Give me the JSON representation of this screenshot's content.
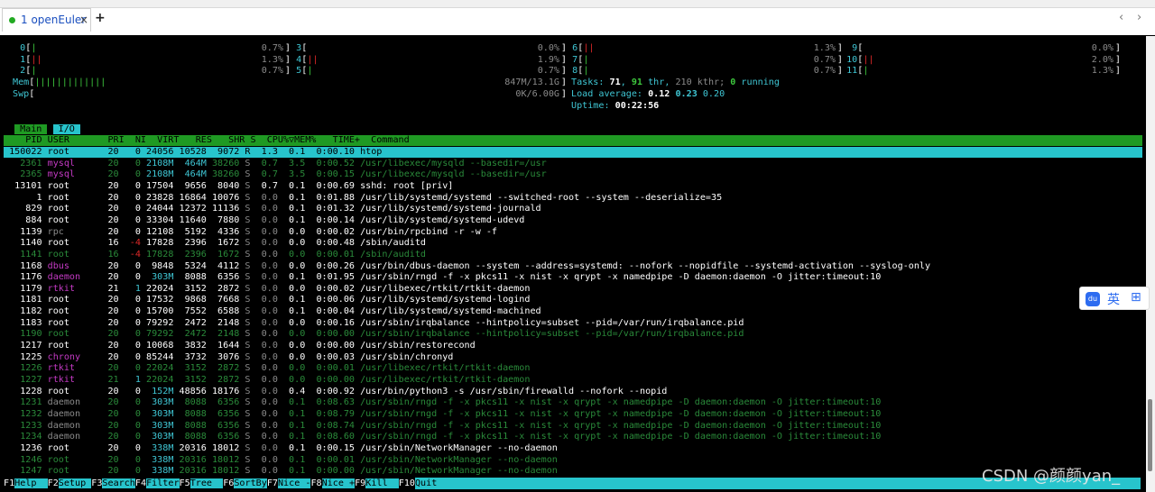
{
  "tab": {
    "label": "1 openEuler",
    "close": "×",
    "new": "+",
    "prev": "‹",
    "next": "›",
    "status_color": "#22aa22"
  },
  "cpu": [
    {
      "id": "0",
      "bar": "|",
      "pct": "0.7%"
    },
    {
      "id": "1",
      "bar": "||",
      "pct": "1.3%"
    },
    {
      "id": "2",
      "bar": "|",
      "pct": "0.7%"
    },
    {
      "id": "3",
      "bar": "",
      "pct": "0.0%"
    },
    {
      "id": "4",
      "bar": "||",
      "pct": "1.9%"
    },
    {
      "id": "5",
      "bar": "|",
      "pct": "0.7%"
    },
    {
      "id": "6",
      "bar": "||",
      "pct": "1.3%"
    },
    {
      "id": "7",
      "bar": "|",
      "pct": "0.7%"
    },
    {
      "id": "8",
      "bar": "|",
      "pct": "0.7%"
    },
    {
      "id": "9",
      "bar": "",
      "pct": "0.0%"
    },
    {
      "id": "10",
      "bar": "||",
      "pct": "2.0%"
    },
    {
      "id": "11",
      "bar": "|",
      "pct": "1.3%"
    }
  ],
  "mem": {
    "label": "Mem",
    "bar": "|||||||||||||",
    "value": "847M/13.1G"
  },
  "swp": {
    "label": "Swp",
    "bar": "",
    "value": "0K/6.00G"
  },
  "tasks": {
    "label": "Tasks:",
    "tasks": "71",
    "sep": ",",
    "thr": "91",
    "thr_label": "thr,",
    "kthr": "210 kthr;",
    "running": "0",
    "running_label": "running"
  },
  "load": {
    "label": "Load average:",
    "v1": "0.12",
    "v2": "0.23",
    "v3": "0.20"
  },
  "uptime": {
    "label": "Uptime:",
    "value": "00:22:56"
  },
  "screen_tabs": {
    "main": "Main",
    "io": "I/O"
  },
  "header": {
    "text": "    PID USER       PRI  NI  VIRT   RES   SHR S  CPU%▽MEM%   TIME+  Command"
  },
  "processes": [
    {
      "pid": "150022",
      "user": "root",
      "pri": "20",
      "ni": "0",
      "virt": "24056",
      "res": "10528",
      "shr": "9072",
      "s": "R",
      "cpu": "1.3",
      "mem": "0.1",
      "time": "0:00.10",
      "cmd": "htop",
      "sel": true
    },
    {
      "pid": "2361",
      "user": "mysql",
      "pri": "20",
      "ni": "0",
      "virt": "2108M",
      "res": "464M",
      "shr": "38260",
      "s": "S",
      "cpu": "0.7",
      "mem": "3.5",
      "time": "0:00.52",
      "cmd": "/usr/libexec/mysqld --basedir=/usr",
      "thread": true,
      "uc": "m"
    },
    {
      "pid": "2365",
      "user": "mysql",
      "pri": "20",
      "ni": "0",
      "virt": "2108M",
      "res": "464M",
      "shr": "38260",
      "s": "S",
      "cpu": "0.7",
      "mem": "3.5",
      "time": "0:00.15",
      "cmd": "/usr/libexec/mysqld --basedir=/usr",
      "thread": true,
      "uc": "m"
    },
    {
      "pid": "13101",
      "user": "root",
      "pri": "20",
      "ni": "0",
      "virt": "17504",
      "res": "9656",
      "shr": "8040",
      "s": "S",
      "cpu": "0.7",
      "mem": "0.1",
      "time": "0:00.69",
      "cmd": "sshd: root [priv]"
    },
    {
      "pid": "1",
      "user": "root",
      "pri": "20",
      "ni": "0",
      "virt": "23828",
      "res": "16864",
      "shr": "10076",
      "s": "S",
      "cpu": "0.0",
      "mem": "0.1",
      "time": "0:01.88",
      "cmd": "/usr/lib/systemd/systemd --switched-root --system --deserialize=35"
    },
    {
      "pid": "829",
      "user": "root",
      "pri": "20",
      "ni": "0",
      "virt": "24044",
      "res": "12372",
      "shr": "11136",
      "s": "S",
      "cpu": "0.0",
      "mem": "0.1",
      "time": "0:01.32",
      "cmd": "/usr/lib/systemd/systemd-journald"
    },
    {
      "pid": "884",
      "user": "root",
      "pri": "20",
      "ni": "0",
      "virt": "33304",
      "res": "11640",
      "shr": "7880",
      "s": "S",
      "cpu": "0.0",
      "mem": "0.1",
      "time": "0:00.14",
      "cmd": "/usr/lib/systemd/systemd-udevd"
    },
    {
      "pid": "1139",
      "user": "rpc",
      "pri": "20",
      "ni": "0",
      "virt": "12108",
      "res": "5192",
      "shr": "4336",
      "s": "S",
      "cpu": "0.0",
      "mem": "0.0",
      "time": "0:00.02",
      "cmd": "/usr/bin/rpcbind -r -w -f",
      "uc": "gr"
    },
    {
      "pid": "1140",
      "user": "root",
      "pri": "16",
      "ni": "-4",
      "virt": "17828",
      "res": "2396",
      "shr": "1672",
      "s": "S",
      "cpu": "0.0",
      "mem": "0.0",
      "time": "0:00.48",
      "cmd": "/sbin/auditd"
    },
    {
      "pid": "1141",
      "user": "root",
      "pri": "16",
      "ni": "-4",
      "virt": "17828",
      "res": "2396",
      "shr": "1672",
      "s": "S",
      "cpu": "0.0",
      "mem": "0.0",
      "time": "0:00.01",
      "cmd": "/sbin/auditd",
      "thread": true
    },
    {
      "pid": "1168",
      "user": "dbus",
      "pri": "20",
      "ni": "0",
      "virt": "9848",
      "res": "5324",
      "shr": "4112",
      "s": "S",
      "cpu": "0.0",
      "mem": "0.0",
      "time": "0:00.26",
      "cmd": "/usr/bin/dbus-daemon --system --address=systemd: --nofork --nopidfile --systemd-activation --syslog-only",
      "uc": "m"
    },
    {
      "pid": "1176",
      "user": "daemon",
      "pri": "20",
      "ni": "0",
      "virt": "303M",
      "res": "8088",
      "shr": "6356",
      "s": "S",
      "cpu": "0.0",
      "mem": "0.1",
      "time": "0:01.95",
      "cmd": "/usr/sbin/rngd -f -x pkcs11 -x nist -x qrypt -x namedpipe -D daemon:daemon -O jitter:timeout:10",
      "uc": "m"
    },
    {
      "pid": "1179",
      "user": "rtkit",
      "pri": "21",
      "ni": "1",
      "virt": "22024",
      "res": "3152",
      "shr": "2872",
      "s": "S",
      "cpu": "0.0",
      "mem": "0.0",
      "time": "0:00.02",
      "cmd": "/usr/libexec/rtkit/rtkit-daemon",
      "uc": "m"
    },
    {
      "pid": "1181",
      "user": "root",
      "pri": "20",
      "ni": "0",
      "virt": "17532",
      "res": "9868",
      "shr": "7668",
      "s": "S",
      "cpu": "0.0",
      "mem": "0.1",
      "time": "0:00.06",
      "cmd": "/usr/lib/systemd/systemd-logind"
    },
    {
      "pid": "1182",
      "user": "root",
      "pri": "20",
      "ni": "0",
      "virt": "15700",
      "res": "7552",
      "shr": "6588",
      "s": "S",
      "cpu": "0.0",
      "mem": "0.1",
      "time": "0:00.04",
      "cmd": "/usr/lib/systemd/systemd-machined"
    },
    {
      "pid": "1183",
      "user": "root",
      "pri": "20",
      "ni": "0",
      "virt": "79292",
      "res": "2472",
      "shr": "2148",
      "s": "S",
      "cpu": "0.0",
      "mem": "0.0",
      "time": "0:00.16",
      "cmd": "/usr/sbin/irqbalance --hintpolicy=subset --pid=/var/run/irqbalance.pid"
    },
    {
      "pid": "1190",
      "user": "root",
      "pri": "20",
      "ni": "0",
      "virt": "79292",
      "res": "2472",
      "shr": "2148",
      "s": "S",
      "cpu": "0.0",
      "mem": "0.0",
      "time": "0:00.00",
      "cmd": "/usr/sbin/irqbalance --hintpolicy=subset --pid=/var/run/irqbalance.pid",
      "thread": true
    },
    {
      "pid": "1217",
      "user": "root",
      "pri": "20",
      "ni": "0",
      "virt": "10068",
      "res": "3832",
      "shr": "1644",
      "s": "S",
      "cpu": "0.0",
      "mem": "0.0",
      "time": "0:00.00",
      "cmd": "/usr/sbin/restorecond"
    },
    {
      "pid": "1225",
      "user": "chrony",
      "pri": "20",
      "ni": "0",
      "virt": "85244",
      "res": "3732",
      "shr": "3076",
      "s": "S",
      "cpu": "0.0",
      "mem": "0.0",
      "time": "0:00.03",
      "cmd": "/usr/sbin/chronyd",
      "uc": "m"
    },
    {
      "pid": "1226",
      "user": "rtkit",
      "pri": "20",
      "ni": "0",
      "virt": "22024",
      "res": "3152",
      "shr": "2872",
      "s": "S",
      "cpu": "0.0",
      "mem": "0.0",
      "time": "0:00.01",
      "cmd": "/usr/libexec/rtkit/rtkit-daemon",
      "thread": true,
      "uc": "m"
    },
    {
      "pid": "1227",
      "user": "rtkit",
      "pri": "21",
      "ni": "1",
      "virt": "22024",
      "res": "3152",
      "shr": "2872",
      "s": "S",
      "cpu": "0.0",
      "mem": "0.0",
      "time": "0:00.00",
      "cmd": "/usr/libexec/rtkit/rtkit-daemon",
      "thread": true,
      "uc": "m"
    },
    {
      "pid": "1228",
      "user": "root",
      "pri": "20",
      "ni": "0",
      "virt": "152M",
      "res": "48856",
      "shr": "18176",
      "s": "S",
      "cpu": "0.0",
      "mem": "0.4",
      "time": "0:00.92",
      "cmd": "/usr/bin/python3 -s /usr/sbin/firewalld --nofork --nopid"
    },
    {
      "pid": "1231",
      "user": "daemon",
      "pri": "20",
      "ni": "0",
      "virt": "303M",
      "res": "8088",
      "shr": "6356",
      "s": "S",
      "cpu": "0.0",
      "mem": "0.1",
      "time": "0:08.63",
      "cmd": "/usr/sbin/rngd -f -x pkcs11 -x nist -x qrypt -x namedpipe -D daemon:daemon -O jitter:timeout:10",
      "thread": true,
      "uc": "gr"
    },
    {
      "pid": "1232",
      "user": "daemon",
      "pri": "20",
      "ni": "0",
      "virt": "303M",
      "res": "8088",
      "shr": "6356",
      "s": "S",
      "cpu": "0.0",
      "mem": "0.1",
      "time": "0:08.79",
      "cmd": "/usr/sbin/rngd -f -x pkcs11 -x nist -x qrypt -x namedpipe -D daemon:daemon -O jitter:timeout:10",
      "thread": true,
      "uc": "gr"
    },
    {
      "pid": "1233",
      "user": "daemon",
      "pri": "20",
      "ni": "0",
      "virt": "303M",
      "res": "8088",
      "shr": "6356",
      "s": "S",
      "cpu": "0.0",
      "mem": "0.1",
      "time": "0:08.74",
      "cmd": "/usr/sbin/rngd -f -x pkcs11 -x nist -x qrypt -x namedpipe -D daemon:daemon -O jitter:timeout:10",
      "thread": true,
      "uc": "gr"
    },
    {
      "pid": "1234",
      "user": "daemon",
      "pri": "20",
      "ni": "0",
      "virt": "303M",
      "res": "8088",
      "shr": "6356",
      "s": "S",
      "cpu": "0.0",
      "mem": "0.1",
      "time": "0:08.60",
      "cmd": "/usr/sbin/rngd -f -x pkcs11 -x nist -x qrypt -x namedpipe -D daemon:daemon -O jitter:timeout:10",
      "thread": true,
      "uc": "gr"
    },
    {
      "pid": "1236",
      "user": "root",
      "pri": "20",
      "ni": "0",
      "virt": "338M",
      "res": "20316",
      "shr": "18012",
      "s": "S",
      "cpu": "0.0",
      "mem": "0.1",
      "time": "0:00.15",
      "cmd": "/usr/sbin/NetworkManager --no-daemon"
    },
    {
      "pid": "1246",
      "user": "root",
      "pri": "20",
      "ni": "0",
      "virt": "338M",
      "res": "20316",
      "shr": "18012",
      "s": "S",
      "cpu": "0.0",
      "mem": "0.1",
      "time": "0:00.01",
      "cmd": "/usr/sbin/NetworkManager --no-daemon",
      "thread": true
    },
    {
      "pid": "1247",
      "user": "root",
      "pri": "20",
      "ni": "0",
      "virt": "338M",
      "res": "20316",
      "shr": "18012",
      "s": "S",
      "cpu": "0.0",
      "mem": "0.1",
      "time": "0:00.00",
      "cmd": "/usr/sbin/NetworkManager --no-daemon",
      "thread": true
    }
  ],
  "fkeys": [
    {
      "k": "F1",
      "l": "Help  "
    },
    {
      "k": "F2",
      "l": "Setup "
    },
    {
      "k": "F3",
      "l": "Search"
    },
    {
      "k": "F4",
      "l": "Filter"
    },
    {
      "k": "F5",
      "l": "Tree  "
    },
    {
      "k": "F6",
      "l": "SortBy"
    },
    {
      "k": "F7",
      "l": "Nice -"
    },
    {
      "k": "F8",
      "l": "Nice +"
    },
    {
      "k": "F9",
      "l": "Kill  "
    },
    {
      "k": "F10",
      "l": "Quit"
    }
  ],
  "ime": {
    "icon": "du",
    "lang": "英",
    "menu": "⊞"
  },
  "watermark": "CSDN @颜颜yan_"
}
